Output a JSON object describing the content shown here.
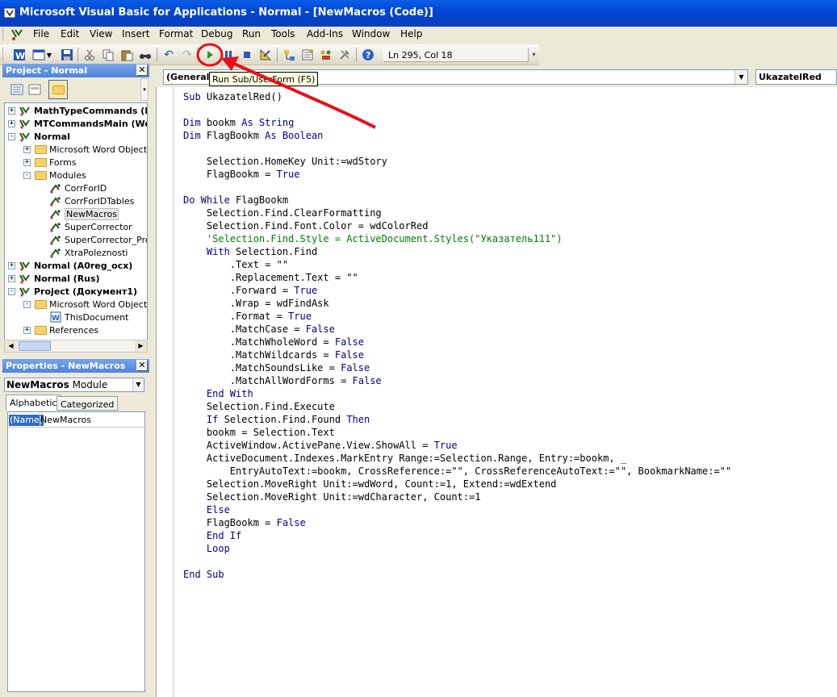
{
  "window": {
    "title": "Microsoft Visual Basic for Applications - Normal - [NewMacros (Code)]"
  },
  "menu": [
    "File",
    "Edit",
    "View",
    "Insert",
    "Format",
    "Debug",
    "Run",
    "Tools",
    "Add-Ins",
    "Window",
    "Help"
  ],
  "toolbar": {
    "status": "Ln 295, Col 18",
    "tooltip": "Run Sub/UserForm (F5)",
    "icons": [
      "word-icon",
      "insert-userform-icon",
      "save-icon",
      "cut-icon",
      "copy-icon",
      "paste-icon",
      "find-icon",
      "undo-icon",
      "redo-icon",
      "run-icon",
      "break-icon",
      "reset-icon",
      "design-mode-icon",
      "project-explorer-icon",
      "properties-icon",
      "object-browser-icon",
      "toolbox-icon",
      "help-icon"
    ]
  },
  "project": {
    "title": "Project - Normal",
    "tree": [
      {
        "label": "MathTypeCommands (M",
        "bold": true,
        "level": 0,
        "exp": "+",
        "icon": "vba-project-icon"
      },
      {
        "label": "MTCommandsMain (Wor",
        "bold": true,
        "level": 0,
        "exp": "+",
        "icon": "vba-project-icon"
      },
      {
        "label": "Normal",
        "bold": true,
        "level": 0,
        "exp": "-",
        "icon": "vba-project-icon"
      },
      {
        "label": "Microsoft Word Objects",
        "bold": false,
        "level": 1,
        "exp": "+",
        "icon": "folder-icon"
      },
      {
        "label": "Forms",
        "bold": false,
        "level": 1,
        "exp": "+",
        "icon": "folder-icon"
      },
      {
        "label": "Modules",
        "bold": false,
        "level": 1,
        "exp": "-",
        "icon": "folder-icon"
      },
      {
        "label": "CorrForID",
        "bold": false,
        "level": 2,
        "exp": "",
        "icon": "module-icon"
      },
      {
        "label": "CorrForIDTables",
        "bold": false,
        "level": 2,
        "exp": "",
        "icon": "module-icon"
      },
      {
        "label": "NewMacros",
        "bold": false,
        "level": 2,
        "exp": "",
        "icon": "module-icon",
        "selected": true
      },
      {
        "label": "SuperCorrector",
        "bold": false,
        "level": 2,
        "exp": "",
        "icon": "module-icon"
      },
      {
        "label": "SuperCorrector_Proc",
        "bold": false,
        "level": 2,
        "exp": "",
        "icon": "module-icon"
      },
      {
        "label": "XtraPoleznosti",
        "bold": false,
        "level": 2,
        "exp": "",
        "icon": "module-icon"
      },
      {
        "label": "Normal (A0reg_осx)",
        "bold": true,
        "level": 0,
        "exp": "+",
        "icon": "vba-project-icon"
      },
      {
        "label": "Normal (Rus)",
        "bold": true,
        "level": 0,
        "exp": "+",
        "icon": "vba-project-icon"
      },
      {
        "label": "Project (Документ1)",
        "bold": true,
        "level": 0,
        "exp": "-",
        "icon": "vba-project-icon"
      },
      {
        "label": "Microsoft Word Objects",
        "bold": false,
        "level": 1,
        "exp": "-",
        "icon": "folder-icon"
      },
      {
        "label": "ThisDocument",
        "bold": false,
        "level": 2,
        "exp": "",
        "icon": "word-doc-icon"
      },
      {
        "label": "References",
        "bold": false,
        "level": 1,
        "exp": "+",
        "icon": "folder-icon"
      }
    ]
  },
  "properties": {
    "title": "Properties - NewMacros",
    "object": "NewMacros",
    "object_type": "Module",
    "tabs": [
      "Alphabetic",
      "Categorized"
    ],
    "prop_name": "(Name)",
    "prop_value": "NewMacros"
  },
  "code": {
    "object_combo": "(General)",
    "proc_combo": "UkazatelRed",
    "lines": [
      [
        [
          "Sub ",
          "kw"
        ],
        [
          "UkazatelRed()",
          ""
        ]
      ],
      [],
      [
        [
          "Dim ",
          "kw"
        ],
        [
          "bookm ",
          ""
        ],
        [
          "As String",
          "kw"
        ]
      ],
      [
        [
          "Dim ",
          "kw"
        ],
        [
          "FlagBookm ",
          ""
        ],
        [
          "As Boolean",
          "kw"
        ]
      ],
      [],
      [
        [
          "    Selection.HomeKey Unit:=wdStory",
          ""
        ]
      ],
      [
        [
          "    FlagBookm = ",
          ""
        ],
        [
          "True",
          "kw"
        ]
      ],
      [],
      [
        [
          "Do While",
          "kw"
        ],
        [
          " FlagBookm",
          ""
        ]
      ],
      [
        [
          "    Selection.Find.ClearFormatting",
          ""
        ]
      ],
      [
        [
          "    Selection.Find.Font.Color = wdColorRed",
          ""
        ]
      ],
      [
        [
          "    'Selection.Find.Style = ActiveDocument.Styles(\"Указатель111\")",
          "cm"
        ]
      ],
      [
        [
          "    ",
          ""
        ],
        [
          "With",
          "kw"
        ],
        [
          " Selection.Find",
          ""
        ]
      ],
      [
        [
          "        .Text = \"\"",
          ""
        ]
      ],
      [
        [
          "        .Replacement.Text = \"\"",
          ""
        ]
      ],
      [
        [
          "        .Forward = ",
          ""
        ],
        [
          "True",
          "kw"
        ]
      ],
      [
        [
          "        .Wrap = wdFindAsk",
          ""
        ]
      ],
      [
        [
          "        .Format = ",
          ""
        ],
        [
          "True",
          "kw"
        ]
      ],
      [
        [
          "        .MatchCase = ",
          ""
        ],
        [
          "False",
          "kw"
        ]
      ],
      [
        [
          "        .MatchWholeWord = ",
          ""
        ],
        [
          "False",
          "kw"
        ]
      ],
      [
        [
          "        .MatchWildcards = ",
          ""
        ],
        [
          "False",
          "kw"
        ]
      ],
      [
        [
          "        .MatchSoundsLike = ",
          ""
        ],
        [
          "False",
          "kw"
        ]
      ],
      [
        [
          "        .MatchAllWordForms = ",
          ""
        ],
        [
          "False",
          "kw"
        ]
      ],
      [
        [
          "    ",
          ""
        ],
        [
          "End With",
          "kw"
        ]
      ],
      [
        [
          "    Selection.Find.Execute",
          ""
        ]
      ],
      [
        [
          "    ",
          ""
        ],
        [
          "If",
          "kw"
        ],
        [
          " Selection.Find.Found ",
          ""
        ],
        [
          "Then",
          "kw"
        ]
      ],
      [
        [
          "    bookm = Selection.Text",
          ""
        ]
      ],
      [
        [
          "    ActiveWindow.ActivePane.View.ShowAll = ",
          ""
        ],
        [
          "True",
          "kw"
        ]
      ],
      [
        [
          "    ActiveDocument.Indexes.MarkEntry Range:=Selection.Range, Entry:=bookm, _",
          ""
        ]
      ],
      [
        [
          "        EntryAutoText:=bookm, CrossReference:=\"\", CrossReferenceAutoText:=\"\", BookmarkName:=\"\"",
          ""
        ]
      ],
      [
        [
          "    Selection.MoveRight Unit:=wdWord, Count:=1, Extend:=wdExtend",
          ""
        ]
      ],
      [
        [
          "    Selection.MoveRight Unit:=wdCharacter, Count:=1",
          ""
        ]
      ],
      [
        [
          "    ",
          ""
        ],
        [
          "Else",
          "kw"
        ]
      ],
      [
        [
          "    FlagBookm = ",
          ""
        ],
        [
          "False",
          "kw"
        ]
      ],
      [
        [
          "    ",
          ""
        ],
        [
          "End If",
          "kw"
        ]
      ],
      [
        [
          "    ",
          ""
        ],
        [
          "Loop",
          "kw"
        ]
      ],
      [],
      [
        [
          "End Sub",
          "kw"
        ]
      ]
    ]
  },
  "colors": {
    "annotation": "#e8101a",
    "title_bar": "#0a5fe6",
    "keyword": "#00008b",
    "comment": "#008000"
  }
}
